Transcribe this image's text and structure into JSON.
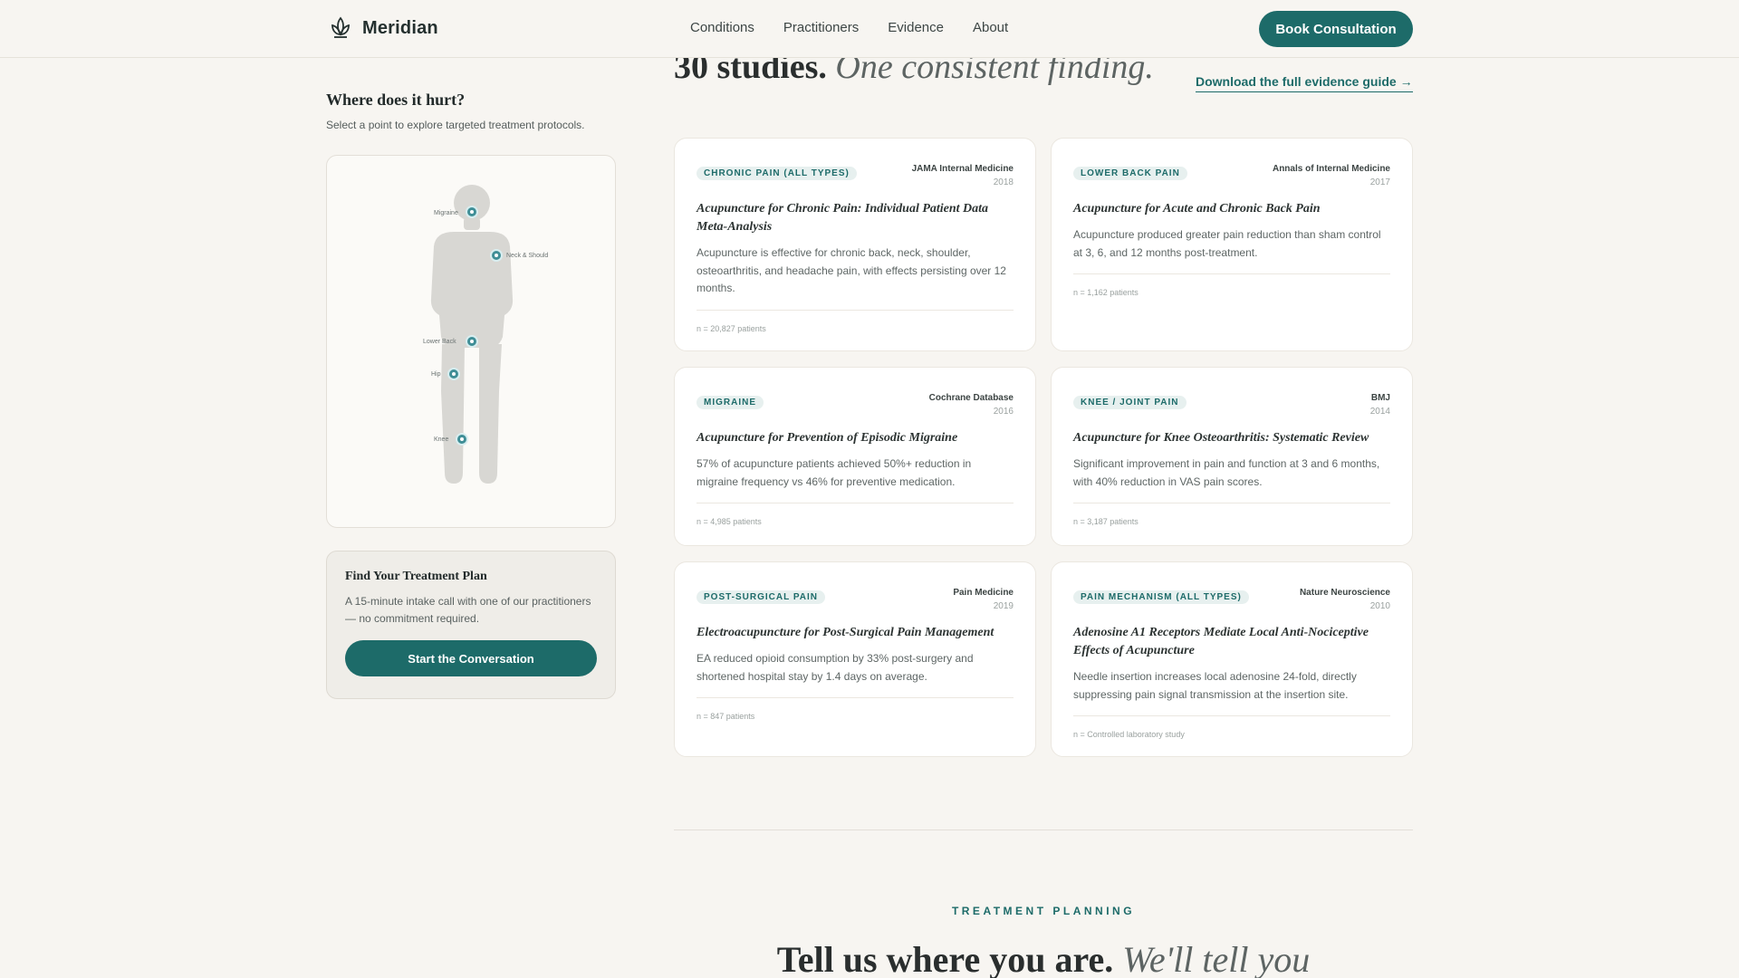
{
  "header": {
    "brand": "Meridian",
    "nav": [
      "Conditions",
      "Practitioners",
      "Evidence",
      "About"
    ],
    "cta": "Book Consultation"
  },
  "sidebar": {
    "question": "Where does it hurt?",
    "subtitle": "Select a point to explore targeted treatment protocols.",
    "points": [
      "Migraine",
      "Neck & Should",
      "Lower Back",
      "Hip",
      "Knee"
    ],
    "plan": {
      "title": "Find Your Treatment Plan",
      "text": "A 15-minute intake call with one of our practitioners — no commitment required.",
      "button": "Start the Conversation"
    }
  },
  "evidence": {
    "headline_bold": "30 studies.",
    "headline_italic": "One consistent finding.",
    "download": "Download the full evidence guide →",
    "studies": [
      {
        "tag": "CHRONIC PAIN (ALL TYPES)",
        "journal": "JAMA Internal Medicine",
        "year": "2018",
        "title": "Acupuncture for Chronic Pain: Individual Patient Data Meta-Analysis",
        "desc": "Acupuncture is effective for chronic back, neck, shoulder, osteoarthritis, and headache pain, with effects persisting over 12 months.",
        "n": "n = 20,827 patients"
      },
      {
        "tag": "LOWER BACK PAIN",
        "journal": "Annals of Internal Medicine",
        "year": "2017",
        "title": "Acupuncture for Acute and Chronic Back Pain",
        "desc": "Acupuncture produced greater pain reduction than sham control at 3, 6, and 12 months post-treatment.",
        "n": "n = 1,162 patients"
      },
      {
        "tag": "MIGRAINE",
        "journal": "Cochrane Database",
        "year": "2016",
        "title": "Acupuncture for Prevention of Episodic Migraine",
        "desc": "57% of acupuncture patients achieved 50%+ reduction in migraine frequency vs 46% for preventive medication.",
        "n": "n = 4,985 patients"
      },
      {
        "tag": "KNEE / JOINT PAIN",
        "journal": "BMJ",
        "year": "2014",
        "title": "Acupuncture for Knee Osteoarthritis: Systematic Review",
        "desc": "Significant improvement in pain and function at 3 and 6 months, with 40% reduction in VAS pain scores.",
        "n": "n = 3,187 patients"
      },
      {
        "tag": "POST-SURGICAL PAIN",
        "journal": "Pain Medicine",
        "year": "2019",
        "title": "Electroacupuncture for Post-Surgical Pain Management",
        "desc": "EA reduced opioid consumption by 33% post-surgery and shortened hospital stay by 1.4 days on average.",
        "n": "n = 847 patients"
      },
      {
        "tag": "PAIN MECHANISM (ALL TYPES)",
        "journal": "Nature Neuroscience",
        "year": "2010",
        "title": "Adenosine A1 Receptors Mediate Local Anti-Nociceptive Effects of Acupuncture",
        "desc": "Needle insertion increases local adenosine 24-fold, directly suppressing pain signal transmission at the insertion site.",
        "n": "n = Controlled laboratory study"
      }
    ]
  },
  "planning": {
    "eyebrow": "TREATMENT PLANNING",
    "headline_bold": "Tell us where you are.",
    "headline_italic": "We'll tell you"
  },
  "colors": {
    "accent": "#1d6b69",
    "background": "#f7f5f1",
    "point": "#3f8e96"
  },
  "icons": {
    "brand": "lotus-logo-icon"
  }
}
